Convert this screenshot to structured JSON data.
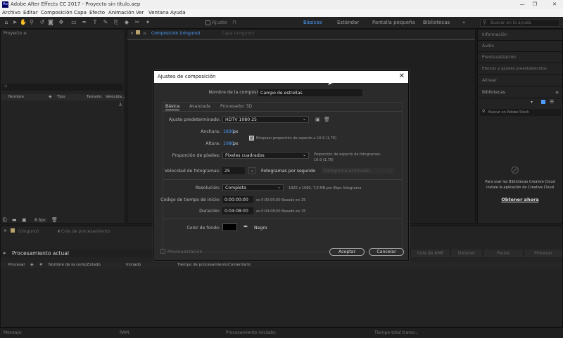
{
  "app": {
    "title": "Adobe After Effects CC 2017 - Proyecto sin título.aep",
    "logo": "Ae"
  },
  "menu": [
    "Archivo",
    "Editar",
    "Composición",
    "Capa",
    "Efecto",
    "Animación",
    "Ver",
    "Ventana",
    "Ayuda"
  ],
  "toolbar": {
    "ajuste_label": "Ajuste",
    "search_placeholder": "Buscar en la ayuda"
  },
  "workspaces": [
    "Básicos",
    "Estándar",
    "Pantalla pequeña",
    "Bibliotecas"
  ],
  "project_panel": {
    "tab": "Proyecto",
    "columns": [
      "Nombre",
      "Tipo",
      "Tamaño",
      "Velocida..."
    ],
    "footer_bpc": "8 bpc"
  },
  "comp_tabs": {
    "composicion": "Composición (ninguno)",
    "capa": "Capa (ninguno)"
  },
  "right_panels": [
    "Información",
    "Audio",
    "Previsualización",
    "Efectos y ajustes preestablecidos",
    "Alinear",
    "Bibliotecas"
  ],
  "libraries": {
    "search_placeholder": "Buscar en Adobe Stock",
    "message": [
      "Para usar las Bibliotecas Creative Cloud",
      "instale la aplicación de Creative Cloud"
    ],
    "link": "Obtener ahora"
  },
  "bottom": {
    "tab1": "(ninguno)",
    "tab2": "Cola de procesamiento",
    "current": "Procesamiento actual",
    "buttons": [
      "Cola de AME",
      "Detener",
      "Pausa",
      "Procesar"
    ],
    "columns": [
      "Procesar",
      "#",
      "Nombre de la comp.",
      "Estado",
      "Iniciado",
      "Tiempo de procesamiento",
      "Comentario"
    ]
  },
  "status_bar": [
    "Mensaje:",
    "RAM:",
    "Procesamiento iniciado:",
    "Tiempo total transc.:"
  ],
  "dialog": {
    "title": "Ajustes de composición",
    "name_label": "Nombre de la composición:",
    "name_value": "Campo de estrellas",
    "tabs": [
      "Básica",
      "Avanzada",
      "Procesador 3D"
    ],
    "preset_label": "Ajuste predeterminado:",
    "preset_value": "HDTV 1080 25",
    "width_label": "Anchura:",
    "width_value": "1920",
    "height_label": "Altura:",
    "height_value": "1080",
    "px": "px",
    "lock_label": "Bloquear proporción de aspecto a 16:9 (1,78)",
    "pixel_label": "Proporción de píxeles:",
    "pixel_value": "Píxeles cuadrados",
    "frame_aspect_1": "Proporción de aspecto de fotogramas:",
    "frame_aspect_2": "16:9 (1,78)",
    "fps_label": "Velocidad de fotogramas:",
    "fps_value": "25",
    "fps_unit": "Fotogramas por segundo",
    "fps_drop": "Fotograma eliminado",
    "res_label": "Resolución:",
    "res_value": "Completa",
    "res_info": "1920 x 1080, 7,9 MB por 8bpc fotograma",
    "start_label": "Código de tiempo de inicio:",
    "start_value": "0:00:00:00",
    "start_info": "es 0:00:00:00  Basado en 25",
    "dur_label": "Duración:",
    "dur_value": "0:04:08:00",
    "dur_info": "es 0:04:08:00  Basado en 25",
    "bg_label": "Color de fondo:",
    "bg_name": "Negro",
    "bg_color": "#000000",
    "preview_label": "Previsualización",
    "ok": "Aceptar",
    "cancel": "Cancelar"
  },
  "colors": {
    "accent": "#4a9eff",
    "bg": "#1d1d1d",
    "panel": "#232323"
  }
}
